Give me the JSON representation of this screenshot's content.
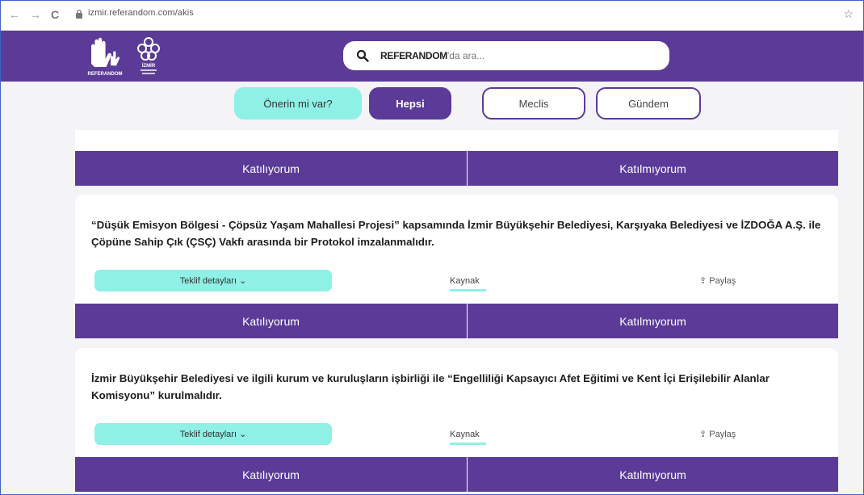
{
  "browser": {
    "back_glyph": "←",
    "forward_glyph": "→",
    "reload_glyph": "C",
    "url": "izmir.referandom.com/akis",
    "bookmark_glyph": "☆"
  },
  "header": {
    "logo_left_text": "REFERANDOM",
    "logo_right_text": "İZMİR",
    "search_brand": "REFERANDOM",
    "search_suffix": "'da ara..."
  },
  "filters": {
    "suggest_label": "Önerin mi var?",
    "all_label": "Hepsi",
    "meclis_label": "Meclis",
    "gundem_label": "Gündem"
  },
  "vote": {
    "yes_label": "Katılıyorum",
    "no_label": "Katılmıyorum"
  },
  "cards": [
    {
      "title": "“Düşük Emisyon Bölgesi - Çöpsüz Yaşam Mahallesi Projesi” kapsamında İzmir Büyükşehir Belediyesi, Karşıyaka Belediyesi ve İZDOĞA A.Ş. ile Çöpüne Sahip Çık (ÇSÇ) Vakfı arasında bir Protokol imzalanmalıdır.",
      "details_label": "Teklif detayları ⌄",
      "source_label": "Kaynak",
      "share_label": "⇪ Paylaş"
    },
    {
      "title": "İzmir Büyükşehir Belediyesi ve ilgili kurum ve kuruluşların işbirliği ile “Engelliliği Kapsayıcı Afet Eğitimi ve Kent İçi Erişilebilir Alanlar Komisyonu” kurulmalıdır.",
      "details_label": "Teklif detayları ⌄",
      "source_label": "Kaynak",
      "share_label": "⇪ Paylaş"
    }
  ],
  "colors": {
    "brand_purple": "#5b3b97",
    "accent_mint": "#8ff0e6"
  }
}
